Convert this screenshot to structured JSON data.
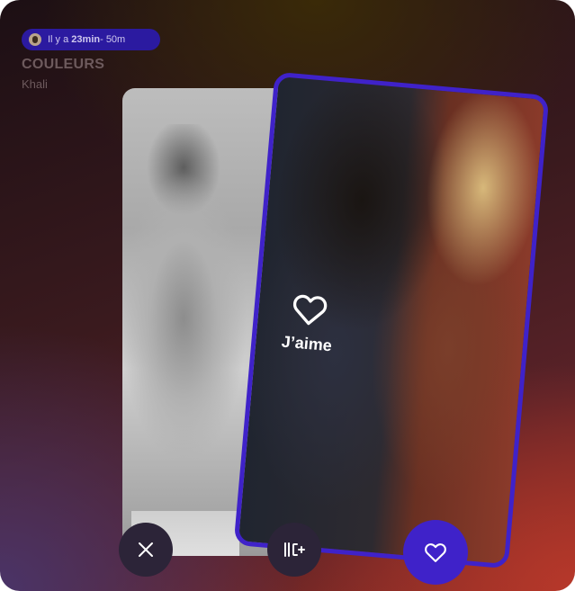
{
  "header": {
    "meta_prefix": "Il y a ",
    "meta_time": "23min",
    "meta_suffix": " - 50m",
    "track_title": "COULEURS",
    "artist": "Khali"
  },
  "card": {
    "overlay_label": "J’aime"
  },
  "actions": {
    "dismiss_icon": "close-icon",
    "add_icon": "add-to-playlist-icon",
    "like_icon": "heart-icon"
  },
  "colors": {
    "accent": "#3f22c9",
    "button_dark": "#2c2438"
  }
}
